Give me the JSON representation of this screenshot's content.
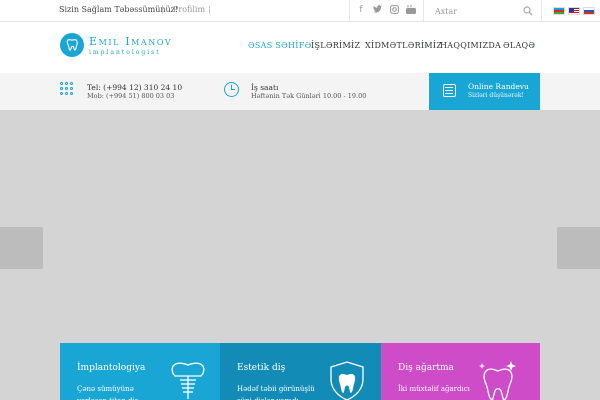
{
  "topbar": {
    "tagline": "Sizin Sağlam Təbəssümünüz!",
    "separator": "|",
    "profile_link": "Profilim",
    "search_placeholder": "Axtar",
    "social_icons": [
      "facebook-icon",
      "twitter-icon",
      "instagram-icon",
      "youtube-icon"
    ],
    "languages": [
      "az",
      "en",
      "ru"
    ]
  },
  "header": {
    "logo_name": "Emil Imanov",
    "logo_sub": "implantologist",
    "nav": [
      {
        "label": "ƏSAS SƏHİFƏ",
        "active": true,
        "dropdown": false
      },
      {
        "label": "İŞLƏRİMİZ",
        "active": false,
        "dropdown": true
      },
      {
        "label": "XİDMƏTLƏRİMİZ",
        "active": false,
        "dropdown": true
      },
      {
        "label": "HAQQIMIZDA",
        "active": false,
        "dropdown": false
      },
      {
        "label": "ƏLAQƏ",
        "active": false,
        "dropdown": true
      }
    ],
    "chevron": "⌄"
  },
  "info": {
    "phone_line1": "Tel: (+994 12) 310 24 10",
    "phone_line2": "Mob: (+994 51) 800 03 03",
    "hours_title": "İş saatı",
    "hours_text": "Həftənin Tək Günləri 10.00 - 19.00",
    "randevu_title": "Online Randevu",
    "randevu_sub": "Sizləri düşünərək!"
  },
  "colors": {
    "accent": "#1aa6d4",
    "card_1": "#1aa6d4",
    "card_2": "#128bb6",
    "card_3": "#cf4cc8",
    "hero_bg": "#d4d4d4"
  },
  "cards": [
    {
      "title": "İmplantologiya",
      "desc": "Çənə sümüyünə yerləşən titan diş",
      "icon": "dental-implant-icon"
    },
    {
      "title": "Estetik diş",
      "desc": "Hədəf təbii görünüşlü süni dişlər yaradı",
      "icon": "tooth-shield-icon"
    },
    {
      "title": "Diş ağartma",
      "desc": "İki müxtəlif ağardıcı",
      "icon": "sparkling-tooth-icon"
    }
  ]
}
